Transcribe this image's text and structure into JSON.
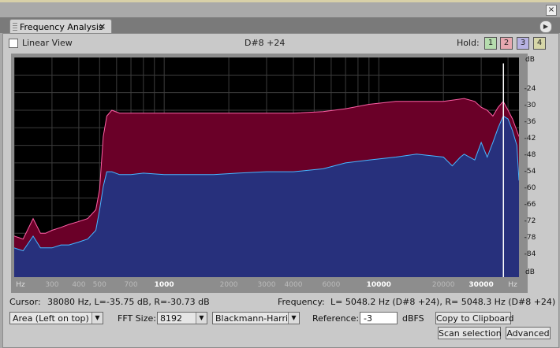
{
  "window": {
    "close_glyph": "×"
  },
  "tab": {
    "title": "Frequency Analysis",
    "close_glyph": "×",
    "menu_glyph": "▶"
  },
  "header": {
    "linear_view_label": "Linear View",
    "linear_view_checked": false,
    "note": "D#8 +24",
    "hold_label": "Hold:",
    "hold_buttons": [
      {
        "label": "1",
        "color": "#b6dcae"
      },
      {
        "label": "2",
        "color": "#e7a8b0"
      },
      {
        "label": "3",
        "color": "#b7b2e2"
      },
      {
        "label": "4",
        "color": "#d6d6a8"
      }
    ]
  },
  "chart_data": {
    "type": "area",
    "xlabel": "Hz",
    "ylabel": "dB",
    "x_scale": "log",
    "xlim": [
      200,
      45000
    ],
    "ylim": [
      -93,
      -18
    ],
    "grid": true,
    "x_tick_labels": [
      "Hz",
      "300",
      "400",
      "500",
      "700",
      "1000",
      "2000",
      "3000",
      "4000",
      "6000",
      "10000",
      "20000",
      "30000",
      "Hz"
    ],
    "y_tick_labels": [
      "dB",
      "-24",
      "-30",
      "-36",
      "-42",
      "-48",
      "-54",
      "-60",
      "-66",
      "-72",
      "-78",
      "-84",
      "dB"
    ],
    "cursor_hz": 38080,
    "colors": {
      "background": "#000000",
      "grid": "#3c3c3c",
      "left_fill": "#6a0028",
      "left_line": "#ff5fa6",
      "right_fill": "#27307c",
      "right_line": "#46b6ff"
    },
    "series": [
      {
        "name": "L",
        "x": [
          200,
          220,
          245,
          265,
          280,
          300,
          330,
          360,
          400,
          440,
          480,
          500,
          520,
          540,
          570,
          620,
          700,
          800,
          1000,
          1300,
          1700,
          2200,
          3000,
          4000,
          5500,
          7000,
          9000,
          12000,
          15000,
          20000,
          25000,
          28000,
          30000,
          32000,
          34000,
          36000,
          38000,
          40000,
          42000,
          44000,
          45000
        ],
        "values": [
          -79,
          -80,
          -73,
          -78,
          -78,
          -77,
          -76,
          -75,
          -74,
          -73,
          -70,
          -63,
          -45,
          -38,
          -36,
          -37,
          -37,
          -37,
          -37,
          -37,
          -37,
          -37,
          -37,
          -37,
          -36.5,
          -35.5,
          -34,
          -33,
          -33,
          -33,
          -32,
          -33,
          -35,
          -36,
          -38,
          -35,
          -33,
          -36,
          -39,
          -43,
          -45
        ]
      },
      {
        "name": "R",
        "x": [
          200,
          220,
          245,
          265,
          280,
          300,
          330,
          360,
          400,
          440,
          480,
          500,
          520,
          540,
          570,
          620,
          700,
          800,
          1000,
          1300,
          1700,
          2200,
          3000,
          4000,
          5500,
          7000,
          9000,
          12000,
          15000,
          20000,
          22000,
          24000,
          25000,
          28000,
          30000,
          32000,
          34000,
          36000,
          38000,
          40000,
          42000,
          44000,
          45000
        ],
        "values": [
          -83,
          -84,
          -79,
          -83,
          -83,
          -83,
          -82,
          -82,
          -81,
          -80,
          -77,
          -70,
          -62,
          -57,
          -57,
          -58,
          -58,
          -57.5,
          -58,
          -58,
          -58,
          -57.5,
          -57,
          -57,
          -56,
          -54,
          -53,
          -52,
          -51,
          -52,
          -55,
          -52,
          -51,
          -53,
          -47,
          -52,
          -47,
          -42,
          -38,
          -39,
          -43,
          -48,
          -60
        ]
      }
    ]
  },
  "status": {
    "cursor_label": "Cursor:",
    "cursor_value": "38080 Hz, L=-35.75 dB, R=-30.73 dB",
    "frequency_label": "Frequency:",
    "frequency_value": "L= 5048.2 Hz (D#8 +24), R= 5048.3 Hz (D#8 +24)"
  },
  "controls": {
    "display_mode": "Area (Left on top)",
    "fft_label": "FFT Size:",
    "fft_value": "8192",
    "window_func": "Blackmann-Harris",
    "reference_label": "Reference:",
    "reference_value": "-3",
    "reference_unit": "dBFS",
    "copy_button": "Copy to Clipboard",
    "scan_button": "Scan selection",
    "advanced_button": "Advanced",
    "arrow_glyph": "▼"
  }
}
